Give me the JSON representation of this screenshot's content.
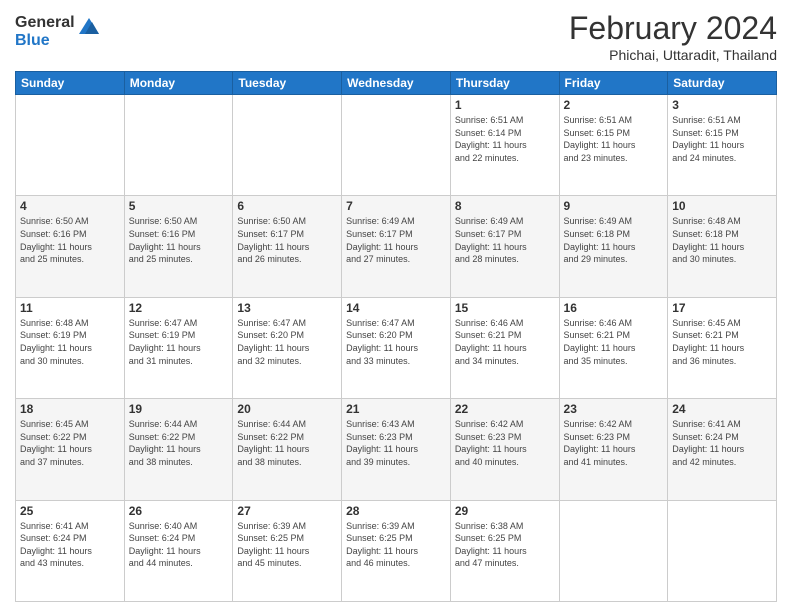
{
  "logo": {
    "general": "General",
    "blue": "Blue"
  },
  "header": {
    "month": "February 2024",
    "location": "Phichai, Uttaradit, Thailand"
  },
  "weekdays": [
    "Sunday",
    "Monday",
    "Tuesday",
    "Wednesday",
    "Thursday",
    "Friday",
    "Saturday"
  ],
  "weeks": [
    [
      {
        "day": "",
        "info": ""
      },
      {
        "day": "",
        "info": ""
      },
      {
        "day": "",
        "info": ""
      },
      {
        "day": "",
        "info": ""
      },
      {
        "day": "1",
        "info": "Sunrise: 6:51 AM\nSunset: 6:14 PM\nDaylight: 11 hours\nand 22 minutes."
      },
      {
        "day": "2",
        "info": "Sunrise: 6:51 AM\nSunset: 6:15 PM\nDaylight: 11 hours\nand 23 minutes."
      },
      {
        "day": "3",
        "info": "Sunrise: 6:51 AM\nSunset: 6:15 PM\nDaylight: 11 hours\nand 24 minutes."
      }
    ],
    [
      {
        "day": "4",
        "info": "Sunrise: 6:50 AM\nSunset: 6:16 PM\nDaylight: 11 hours\nand 25 minutes."
      },
      {
        "day": "5",
        "info": "Sunrise: 6:50 AM\nSunset: 6:16 PM\nDaylight: 11 hours\nand 25 minutes."
      },
      {
        "day": "6",
        "info": "Sunrise: 6:50 AM\nSunset: 6:17 PM\nDaylight: 11 hours\nand 26 minutes."
      },
      {
        "day": "7",
        "info": "Sunrise: 6:49 AM\nSunset: 6:17 PM\nDaylight: 11 hours\nand 27 minutes."
      },
      {
        "day": "8",
        "info": "Sunrise: 6:49 AM\nSunset: 6:17 PM\nDaylight: 11 hours\nand 28 minutes."
      },
      {
        "day": "9",
        "info": "Sunrise: 6:49 AM\nSunset: 6:18 PM\nDaylight: 11 hours\nand 29 minutes."
      },
      {
        "day": "10",
        "info": "Sunrise: 6:48 AM\nSunset: 6:18 PM\nDaylight: 11 hours\nand 30 minutes."
      }
    ],
    [
      {
        "day": "11",
        "info": "Sunrise: 6:48 AM\nSunset: 6:19 PM\nDaylight: 11 hours\nand 30 minutes."
      },
      {
        "day": "12",
        "info": "Sunrise: 6:47 AM\nSunset: 6:19 PM\nDaylight: 11 hours\nand 31 minutes."
      },
      {
        "day": "13",
        "info": "Sunrise: 6:47 AM\nSunset: 6:20 PM\nDaylight: 11 hours\nand 32 minutes."
      },
      {
        "day": "14",
        "info": "Sunrise: 6:47 AM\nSunset: 6:20 PM\nDaylight: 11 hours\nand 33 minutes."
      },
      {
        "day": "15",
        "info": "Sunrise: 6:46 AM\nSunset: 6:21 PM\nDaylight: 11 hours\nand 34 minutes."
      },
      {
        "day": "16",
        "info": "Sunrise: 6:46 AM\nSunset: 6:21 PM\nDaylight: 11 hours\nand 35 minutes."
      },
      {
        "day": "17",
        "info": "Sunrise: 6:45 AM\nSunset: 6:21 PM\nDaylight: 11 hours\nand 36 minutes."
      }
    ],
    [
      {
        "day": "18",
        "info": "Sunrise: 6:45 AM\nSunset: 6:22 PM\nDaylight: 11 hours\nand 37 minutes."
      },
      {
        "day": "19",
        "info": "Sunrise: 6:44 AM\nSunset: 6:22 PM\nDaylight: 11 hours\nand 38 minutes."
      },
      {
        "day": "20",
        "info": "Sunrise: 6:44 AM\nSunset: 6:22 PM\nDaylight: 11 hours\nand 38 minutes."
      },
      {
        "day": "21",
        "info": "Sunrise: 6:43 AM\nSunset: 6:23 PM\nDaylight: 11 hours\nand 39 minutes."
      },
      {
        "day": "22",
        "info": "Sunrise: 6:42 AM\nSunset: 6:23 PM\nDaylight: 11 hours\nand 40 minutes."
      },
      {
        "day": "23",
        "info": "Sunrise: 6:42 AM\nSunset: 6:23 PM\nDaylight: 11 hours\nand 41 minutes."
      },
      {
        "day": "24",
        "info": "Sunrise: 6:41 AM\nSunset: 6:24 PM\nDaylight: 11 hours\nand 42 minutes."
      }
    ],
    [
      {
        "day": "25",
        "info": "Sunrise: 6:41 AM\nSunset: 6:24 PM\nDaylight: 11 hours\nand 43 minutes."
      },
      {
        "day": "26",
        "info": "Sunrise: 6:40 AM\nSunset: 6:24 PM\nDaylight: 11 hours\nand 44 minutes."
      },
      {
        "day": "27",
        "info": "Sunrise: 6:39 AM\nSunset: 6:25 PM\nDaylight: 11 hours\nand 45 minutes."
      },
      {
        "day": "28",
        "info": "Sunrise: 6:39 AM\nSunset: 6:25 PM\nDaylight: 11 hours\nand 46 minutes."
      },
      {
        "day": "29",
        "info": "Sunrise: 6:38 AM\nSunset: 6:25 PM\nDaylight: 11 hours\nand 47 minutes."
      },
      {
        "day": "",
        "info": ""
      },
      {
        "day": "",
        "info": ""
      }
    ]
  ]
}
